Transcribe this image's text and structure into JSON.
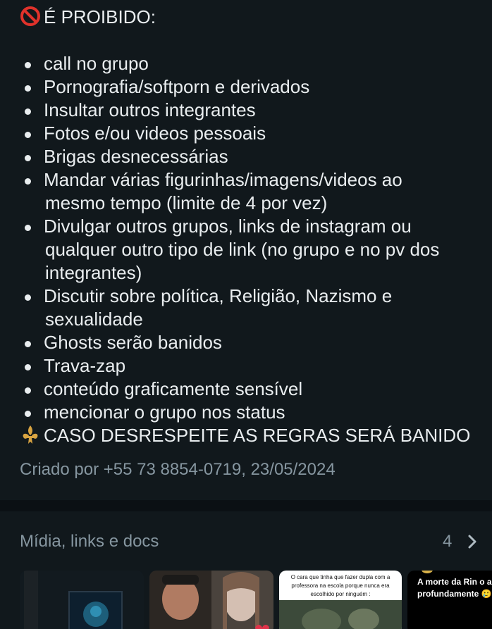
{
  "description": {
    "header_icon": "prohibited-icon",
    "header": "É PROIBIDO:",
    "rules": [
      " call no grupo",
      "Pornografia/softporn e derivados",
      "Insultar outros integrantes",
      "Fotos e/ou videos pessoais",
      "Brigas desnecessárias",
      "Mandar várias figurinhas/imagens/videos ao",
      "mesmo tempo (limite de 4 por vez)",
      "Divulgar outros grupos, links de instagram ou",
      "qualquer outro tipo de link  (no grupo e no pv dos",
      "integrantes)",
      "Discutir sobre política, Religião, Nazismo e",
      "sexualidade",
      "Ghosts serão banidos",
      "Trava-zap",
      " conteúdo graficamente sensível",
      "mencionar o grupo nos status"
    ],
    "footer_icon": "fleur-de-lis-icon",
    "footer": "CASO DESRESPEITE AS REGRAS SERÁ BANIDO",
    "created": "Criado por +55 73 8854-0719, 23/05/2024"
  },
  "media": {
    "title": "Mídia, links e docs",
    "count": "4",
    "thumb3_caption": "O cara que tinha que fazer dupla com a professora na escola porque nunca era escolhido por ninguém :",
    "thumb4_caption": "A morte da Rin o a profundamente 🥲"
  },
  "colors": {
    "background": "#11181c",
    "text": "#e9edef",
    "muted": "#8696a0",
    "divider": "#0b1014"
  }
}
